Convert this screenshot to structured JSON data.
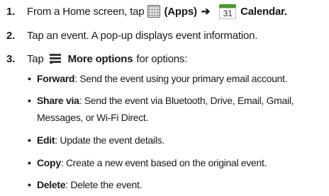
{
  "steps": [
    {
      "number": "1.",
      "text_before": "From a Home screen, tap",
      "apps_label": "(Apps)",
      "arrow": "➔",
      "calendar_icon_day": "31",
      "calendar_label": "Calendar."
    },
    {
      "number": "2.",
      "text": "Tap an event. A pop-up displays event information."
    },
    {
      "number": "3.",
      "text_before": "Tap",
      "menu_label": "More options",
      "text_after": "for options:"
    }
  ],
  "options": [
    {
      "term": "Forward",
      "description": ": Send the event using your primary email account."
    },
    {
      "term": "Share via",
      "description": ": Send the event via Bluetooth, Drive, Email, Gmail,",
      "continuation": "Messages, or Wi-Fi Direct."
    },
    {
      "term": "Edit",
      "description": ": Update the event details."
    },
    {
      "term": "Copy",
      "description": ": Create a new event based on the original event."
    },
    {
      "term": "Delete",
      "description": ": Delete the event."
    }
  ],
  "bullet_glyph": "•"
}
